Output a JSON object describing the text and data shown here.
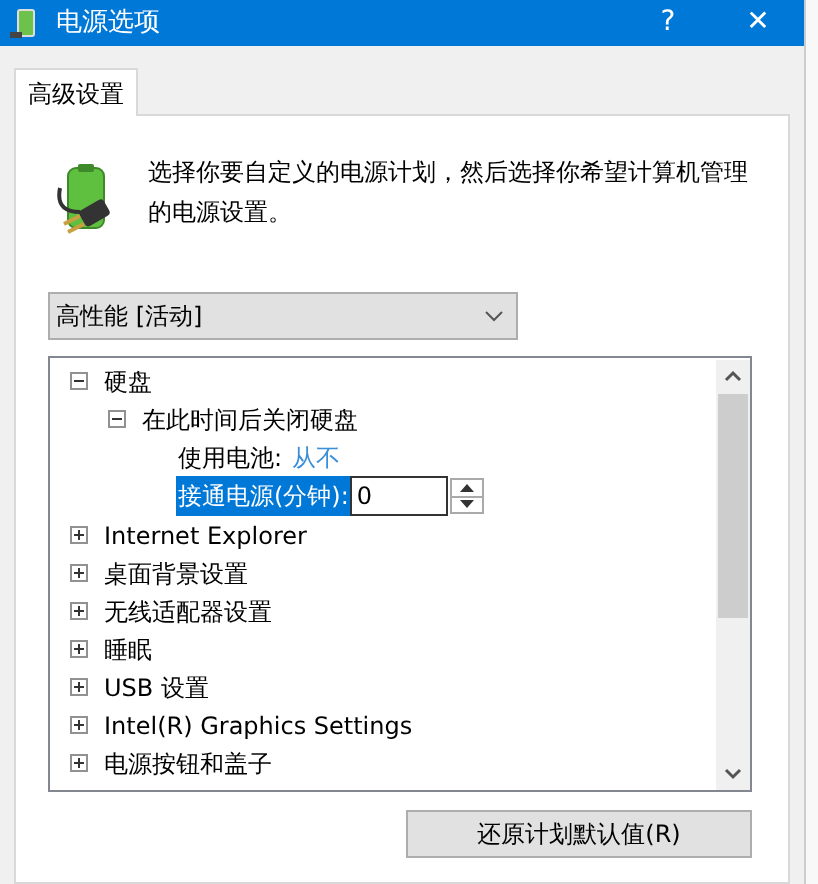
{
  "window": {
    "title": "电源选项",
    "help": "?",
    "close": "✕"
  },
  "tabs": [
    {
      "label": "高级设置",
      "selected": true
    }
  ],
  "description": "选择你要自定义的电源计划，然后选择你希望计算机管理的电源设置。",
  "plan_dropdown": {
    "value": "高性能 [活动]"
  },
  "tree": [
    {
      "label": "硬盘",
      "expanded": true,
      "children": [
        {
          "label": "在此时间后关闭硬盘",
          "expanded": true,
          "children": [
            {
              "kind": "value",
              "label": "使用电池:",
              "value": "从不",
              "selected": false
            },
            {
              "kind": "spin",
              "label": "接通电源(分钟):",
              "value": "0",
              "selected": true
            }
          ]
        }
      ]
    },
    {
      "label": "Internet Explorer",
      "expanded": false
    },
    {
      "label": "桌面背景设置",
      "expanded": false
    },
    {
      "label": "无线适配器设置",
      "expanded": false
    },
    {
      "label": "睡眠",
      "expanded": false
    },
    {
      "label": "USB 设置",
      "expanded": false
    },
    {
      "label": "Intel(R) Graphics Settings",
      "expanded": false
    },
    {
      "label": "电源按钮和盖子",
      "expanded": false
    }
  ],
  "restore_button": "还原计划默认值(R)"
}
